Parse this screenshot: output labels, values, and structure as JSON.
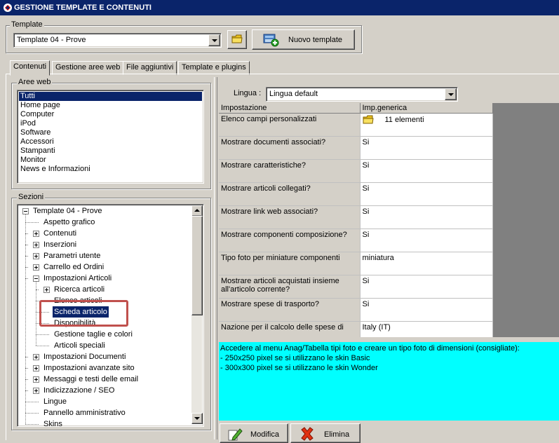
{
  "window": {
    "title": "GESTIONE TEMPLATE E CONTENUTI",
    "icon": "app-gear-icon"
  },
  "template": {
    "group_label": "Template",
    "selected": "Template 04 - Prove",
    "folder_icon": "folder-icon",
    "new_button": "Nuovo template",
    "new_icon": "new-template-icon"
  },
  "tabs": [
    {
      "label": "Contenuti",
      "active": true
    },
    {
      "label": "Gestione aree web",
      "active": false
    },
    {
      "label": "File aggiuntivi",
      "active": false
    },
    {
      "label": "Template e plugins",
      "active": false
    }
  ],
  "aree_web": {
    "label": "Aree web",
    "items": [
      "Tutti",
      "Home page",
      "Computer",
      "iPod",
      "Software",
      "Accessori",
      "Stampanti",
      "Monitor",
      "News e Informazioni"
    ],
    "selected_index": 0
  },
  "sezioni": {
    "label": "Sezioni",
    "tree": [
      {
        "label": "Template 04 - Prove",
        "level": 0,
        "box": "minus"
      },
      {
        "label": "Aspetto grafico",
        "level": 1,
        "box": "none"
      },
      {
        "label": "Contenuti",
        "level": 1,
        "box": "plus"
      },
      {
        "label": "Inserzioni",
        "level": 1,
        "box": "plus"
      },
      {
        "label": "Parametri utente",
        "level": 1,
        "box": "plus"
      },
      {
        "label": "Carrello ed Ordini",
        "level": 1,
        "box": "plus"
      },
      {
        "label": "Impostazioni Articoli",
        "level": 1,
        "box": "minus"
      },
      {
        "label": "Ricerca articoli",
        "level": 2,
        "box": "plus"
      },
      {
        "label": "Elenco articoli",
        "level": 2,
        "box": "none"
      },
      {
        "label": "Scheda articolo",
        "level": 2,
        "box": "none",
        "selected": true
      },
      {
        "label": "Disponibilità",
        "level": 2,
        "box": "none"
      },
      {
        "label": "Gestione taglie e colori",
        "level": 2,
        "box": "none"
      },
      {
        "label": "Articoli speciali",
        "level": 2,
        "box": "none"
      },
      {
        "label": "Impostazioni Documenti",
        "level": 1,
        "box": "plus"
      },
      {
        "label": "Impostazioni avanzate sito",
        "level": 1,
        "box": "plus"
      },
      {
        "label": "Messaggi e testi delle email",
        "level": 1,
        "box": "plus"
      },
      {
        "label": "Indicizzazione / SEO",
        "level": 1,
        "box": "plus"
      },
      {
        "label": "Lingue",
        "level": 1,
        "box": "none"
      },
      {
        "label": "Pannello amministrativo",
        "level": 1,
        "box": "none"
      },
      {
        "label": "Skins",
        "level": 1,
        "box": "none"
      }
    ]
  },
  "lingua": {
    "label": "Lingua :",
    "selected": "Lingua default"
  },
  "grid": {
    "headers": [
      "Impostazione",
      "Imp.generica"
    ],
    "rows": [
      {
        "setting": "Elenco campi personalizzati",
        "value": "11 elementi",
        "icon": "folder-icon"
      },
      {
        "setting": "Mostrare documenti associati?",
        "value": "Si"
      },
      {
        "setting": "Mostrare caratteristiche?",
        "value": "Si"
      },
      {
        "setting": "Mostrare articoli collegati?",
        "value": "Si"
      },
      {
        "setting": "Mostrare link web associati?",
        "value": "Si"
      },
      {
        "setting": "Mostrare componenti composizione?",
        "value": "Si"
      },
      {
        "setting": "Tipo foto per miniature componenti",
        "value": "miniatura"
      },
      {
        "setting": "Mostrare articoli acquistati insieme all'articolo corrente?",
        "value": "Si"
      },
      {
        "setting": "Mostrare spese di trasporto?",
        "value": "Si"
      },
      {
        "setting": "Nazione per il calcolo delle spese di",
        "value": "Italy (IT)"
      }
    ]
  },
  "description": {
    "lines": [
      "Accedere al menu Anag/Tabella tipi foto e creare un tipo foto di dimensioni (consigliate):",
      "- 250x250 pixel se si utilizzano le skin Basic",
      "- 300x300 pixel se si utilizzano le skin Wonder"
    ]
  },
  "actions": {
    "modifica": "Modifica",
    "elimina": "Elimina",
    "modifica_icon": "edit-pencil-icon",
    "elimina_icon": "delete-x-icon"
  },
  "colors": {
    "titlebar": "#0a246a",
    "selection": "#0a246a",
    "description_bg": "#00ffff",
    "highlight": "#c0504d",
    "face": "#d4d0c8"
  }
}
